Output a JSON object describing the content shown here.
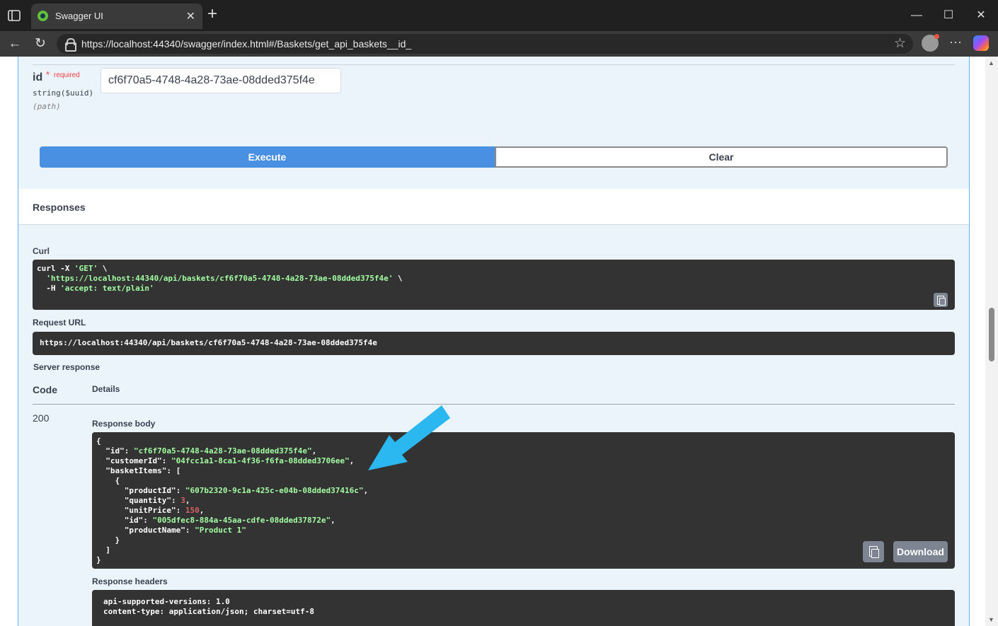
{
  "browser": {
    "tab_title": "Swagger UI",
    "tab_close": "✕",
    "new_tab": "+",
    "url": "https://localhost:44340/swagger/index.html#/Baskets/get_api_baskets__id_",
    "window_minimize": "—",
    "window_maximize": "☐",
    "window_close": "✕",
    "back": "←",
    "reload": "↻",
    "favorite": "☆",
    "more": "···"
  },
  "parameter": {
    "name": "id",
    "required_star": "*",
    "required_label": "required",
    "type": "string($uuid)",
    "location": "(path)",
    "value": "cf6f70a5-4748-4a28-73ae-08dded375f4e"
  },
  "actions": {
    "execute": "Execute",
    "clear": "Clear"
  },
  "responses": {
    "title": "Responses",
    "curl_label": "Curl",
    "curl_line1_cmd": "curl -X ",
    "curl_line1_method": "'GET'",
    "curl_line1_tail": " \\",
    "curl_line2_url": "'https://localhost:44340/api/baskets/cf6f70a5-4748-4a28-73ae-08dded375f4e'",
    "curl_line2_tail": " \\",
    "curl_line3_flag": "  -H ",
    "curl_line3_header": "'accept: text/plain'",
    "request_url_label": "Request URL",
    "request_url": "https://localhost:44340/api/baskets/cf6f70a5-4748-4a28-73ae-08dded375f4e",
    "server_response_label": "Server response",
    "code_header": "Code",
    "details_header": "Details",
    "status_code": "200",
    "response_body_label": "Response body",
    "body": {
      "id": "\"cf6f70a5-4748-4a28-73ae-08dded375f4e\"",
      "customerId": "\"04fcc1a1-8ca1-4f36-f6fa-08dded3706ee\"",
      "productId": "\"607b2320-9c1a-425c-e04b-08dded37416c\"",
      "quantity": "3",
      "unitPrice": "150",
      "item_id": "\"005dfec8-884a-45aa-cdfe-08dded37872e\"",
      "productName": "\"Product 1\""
    },
    "download": "Download",
    "response_headers_label": "Response headers",
    "headers_line1": "api-supported-versions: 1.0",
    "headers_line2": "content-type: application/json; charset=utf-8"
  },
  "annotation": {
    "arrow_color": "#2bb7f0"
  }
}
